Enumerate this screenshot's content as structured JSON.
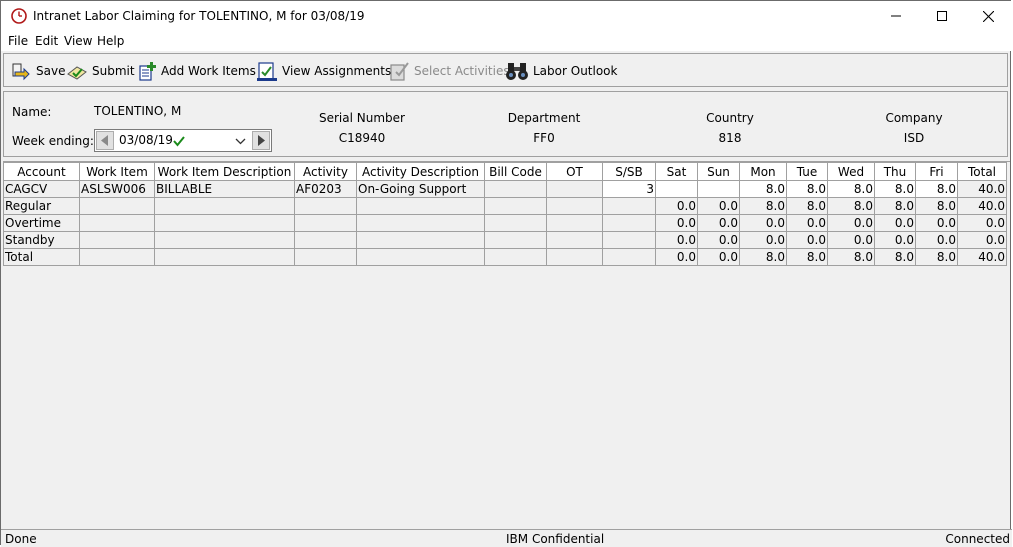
{
  "window": {
    "title": "Intranet Labor Claiming for TOLENTINO, M for 03/08/19"
  },
  "menu": [
    "File",
    "Edit",
    "View",
    "Help"
  ],
  "toolbar": {
    "save": "Save",
    "submit": "Submit",
    "add_work_items": "Add Work Items",
    "view_assignments": "View Assignments",
    "select_activities": "Select Activities",
    "labor_outlook": "Labor Outlook"
  },
  "info": {
    "name_label": "Name:",
    "name_value": "TOLENTINO, M",
    "week_label": "Week ending:",
    "week_value": "03/08/19",
    "serial_label": "Serial Number",
    "serial_value": "C18940",
    "department_label": "Department",
    "department_value": "FF0",
    "country_label": "Country",
    "country_value": "818",
    "company_label": "Company",
    "company_value": "ISD"
  },
  "grid": {
    "columns": [
      "Account",
      "Work Item",
      "Work Item Description",
      "Activity",
      "Activity Description",
      "Bill Code",
      "OT",
      "S/SB",
      "Sat",
      "Sun",
      "Mon",
      "Tue",
      "Wed",
      "Thu",
      "Fri",
      "Total"
    ],
    "rows": [
      [
        "CAGCV",
        "ASLSW006",
        "BILLABLE",
        "AF0203",
        "On-Going Support",
        "",
        "",
        "3",
        "",
        "",
        "8.0",
        "8.0",
        "8.0",
        "8.0",
        "8.0",
        "40.0"
      ],
      [
        "Regular",
        "",
        "",
        "",
        "",
        "",
        "",
        "",
        "0.0",
        "0.0",
        "8.0",
        "8.0",
        "8.0",
        "8.0",
        "8.0",
        "40.0"
      ],
      [
        "Overtime",
        "",
        "",
        "",
        "",
        "",
        "",
        "",
        "0.0",
        "0.0",
        "0.0",
        "0.0",
        "0.0",
        "0.0",
        "0.0",
        "0.0"
      ],
      [
        "Standby",
        "",
        "",
        "",
        "",
        "",
        "",
        "",
        "0.0",
        "0.0",
        "0.0",
        "0.0",
        "0.0",
        "0.0",
        "0.0",
        "0.0"
      ],
      [
        "Total",
        "",
        "",
        "",
        "",
        "",
        "",
        "",
        "0.0",
        "0.0",
        "8.0",
        "8.0",
        "8.0",
        "8.0",
        "8.0",
        "40.0"
      ]
    ]
  },
  "status": {
    "left": "Done",
    "center": "IBM Confidential",
    "right": "Connected"
  }
}
